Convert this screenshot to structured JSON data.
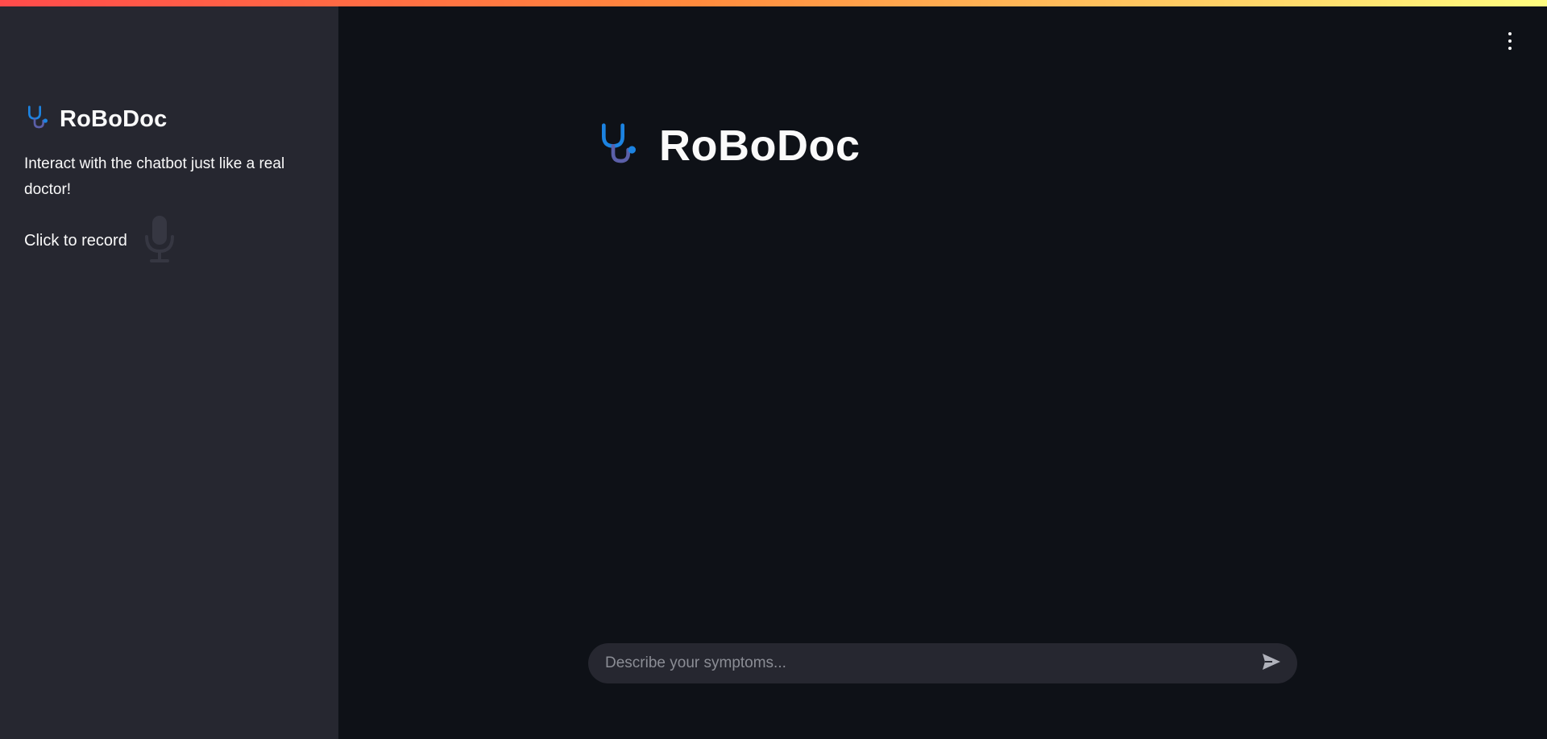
{
  "app": {
    "accent_gradient": [
      "#ff4b4b",
      "#fffd80"
    ],
    "background": "#0e1117",
    "sidebar_background": "#262730"
  },
  "sidebar": {
    "logo_icon": "stethoscope-icon",
    "title": "RoBoDoc",
    "description": "Interact with the chatbot just like a real doctor!",
    "record_label": "Click to record",
    "record_icon": "microphone-icon"
  },
  "main": {
    "logo_icon": "stethoscope-icon",
    "title": "RoBoDoc",
    "menu_icon": "kebab-menu-icon"
  },
  "chat": {
    "placeholder": "Describe your symptoms...",
    "value": "",
    "send_icon": "send-icon"
  }
}
